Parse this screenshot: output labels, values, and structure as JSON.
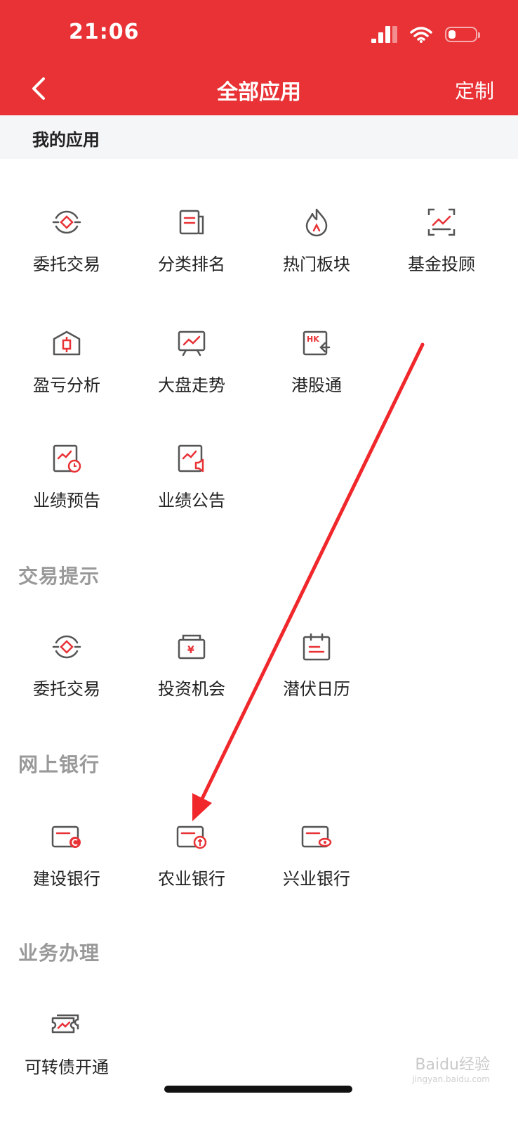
{
  "status_bar": {
    "time": "21:06"
  },
  "header": {
    "title": "全部应用",
    "customize_label": "定制",
    "back_icon": "chevron-left-icon"
  },
  "my_apps": {
    "title": "我的应用",
    "items": [
      {
        "label": "委托交易",
        "icon": "delegate-trade-icon"
      },
      {
        "label": "分类排名",
        "icon": "category-ranking-icon"
      },
      {
        "label": "热门板块",
        "icon": "hot-sector-icon"
      },
      {
        "label": "基金投顾",
        "icon": "fund-advisor-icon"
      },
      {
        "label": "盈亏分析",
        "icon": "profit-loss-icon"
      },
      {
        "label": "大盘走势",
        "icon": "market-trend-icon"
      },
      {
        "label": "港股通",
        "icon": "hk-connect-icon"
      },
      {
        "label": "业绩预告",
        "icon": "earnings-forecast-icon"
      },
      {
        "label": "业绩公告",
        "icon": "earnings-announcement-icon"
      }
    ]
  },
  "trade_tips": {
    "title": "交易提示",
    "items": [
      {
        "label": "委托交易",
        "icon": "delegate-trade-icon"
      },
      {
        "label": "投资机会",
        "icon": "investment-opportunity-icon"
      },
      {
        "label": "潜伏日历",
        "icon": "calendar-icon"
      }
    ]
  },
  "online_banking": {
    "title": "网上银行",
    "items": [
      {
        "label": "建设银行",
        "icon": "ccb-card-icon"
      },
      {
        "label": "农业银行",
        "icon": "abc-card-icon"
      },
      {
        "label": "兴业银行",
        "icon": "cib-card-icon"
      }
    ]
  },
  "business": {
    "title": "业务办理",
    "items": [
      {
        "label": "可转债开通",
        "icon": "convertible-bond-icon"
      }
    ]
  },
  "watermark": {
    "brand": "Baidu经验",
    "url": "jingyan.baidu.com"
  },
  "colors": {
    "brand_red": "#E83236",
    "icon_gray": "#555555",
    "icon_red": "#E83236"
  }
}
